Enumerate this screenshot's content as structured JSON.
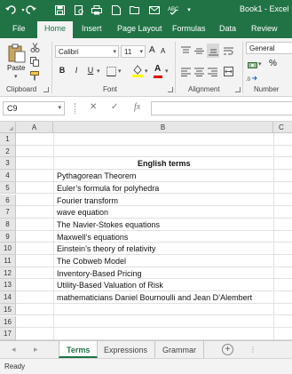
{
  "title_bar": {
    "title": "Book1 - Excel",
    "quick_access": [
      "undo-icon",
      "redo-icon",
      "save-icon",
      "print-preview-icon",
      "print-icon",
      "new-icon",
      "open-icon",
      "email-icon",
      "spelling-icon",
      "customize-icon"
    ]
  },
  "ribbon_tabs": [
    "File",
    "Home",
    "Insert",
    "Page Layout",
    "Formulas",
    "Data",
    "Review"
  ],
  "active_tab": "Home",
  "ribbon": {
    "clipboard": {
      "paste_label": "Paste",
      "group_label": "Clipboard"
    },
    "font": {
      "font_name": "Calibri",
      "font_size": "11",
      "group_label": "Font",
      "bold": "B",
      "italic": "I",
      "underline": "U",
      "grow": "A",
      "shrink": "A",
      "font_color_glyph": "A"
    },
    "alignment": {
      "group_label": "Alignment"
    },
    "number": {
      "format": "General",
      "percent": "%",
      "group_label": "Number"
    }
  },
  "formula_bar": {
    "name_box": "C9",
    "cancel": "✕",
    "enter": "✓",
    "function": "fx",
    "formula": ""
  },
  "columns": [
    "A",
    "B",
    "C"
  ],
  "rows": [
    "1",
    "2",
    "3",
    "4",
    "5",
    "6",
    "7",
    "8",
    "9",
    "10",
    "11",
    "12",
    "13",
    "14",
    "15",
    "16",
    "17"
  ],
  "cells": {
    "B3": "English terms",
    "B4": "Pythagorean Theorem",
    "B5": "Euler’s formula for polyhedra",
    "B6": "Fourier transform",
    "B7": "wave equation",
    "B8": "The Navier-Stokes equations",
    "B9": "Maxwell’s equations",
    "B10": "Einstein’s theory of relativity",
    "B11": "The Cobweb Model",
    "B12": "Inventory-Based Pricing",
    "B13": "Utility-Based Valuation of Risk",
    "B14": "mathematicians Daniel Bournoulli and Jean D’Alembert"
  },
  "sheet_tabs": [
    "Terms",
    "Expressions",
    "Grammar"
  ],
  "active_sheet": "Terms",
  "add_sheet": "+",
  "status": "Ready",
  "colors": {
    "excel_green": "#217346",
    "ribbon_bg": "#f3f3f3",
    "header_bg": "#e6e6e6"
  }
}
